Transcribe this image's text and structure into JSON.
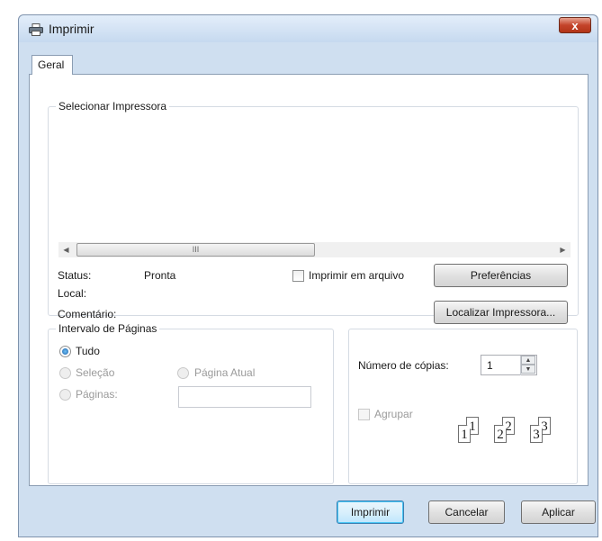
{
  "window": {
    "title": "Imprimir",
    "close_label": "x"
  },
  "tabs": [
    {
      "label": "Geral"
    }
  ],
  "select_printer": {
    "group_label": "Selecionar Impressora",
    "scrollbar": {
      "left_arrow": "◀",
      "right_arrow": "▶",
      "thumb_grip": "III"
    },
    "status_label": "Status:",
    "status_value": "Pronta",
    "location_label": "Local:",
    "location_value": "",
    "comment_label": "Comentário:",
    "comment_value": "",
    "print_to_file_label": "Imprimir em arquivo",
    "print_to_file_checked": false,
    "preferences_button": "Preferências",
    "find_printer_button": "Localizar Impressora..."
  },
  "page_range": {
    "group_label": "Intervalo de Páginas",
    "all_label": "Tudo",
    "all_selected": true,
    "selection_label": "Seleção",
    "current_page_label": "Página Atual",
    "pages_label": "Páginas:",
    "pages_value": ""
  },
  "copies": {
    "number_label": "Número de cópias:",
    "number_value": "1",
    "collate_label": "Agrupar",
    "collate_checked": false,
    "collate_pages": [
      {
        "back": "1",
        "front": "1"
      },
      {
        "back": "2",
        "front": "2"
      },
      {
        "back": "3",
        "front": "3"
      }
    ]
  },
  "buttons": {
    "print": "Imprimir",
    "cancel": "Cancelar",
    "apply": "Aplicar"
  }
}
